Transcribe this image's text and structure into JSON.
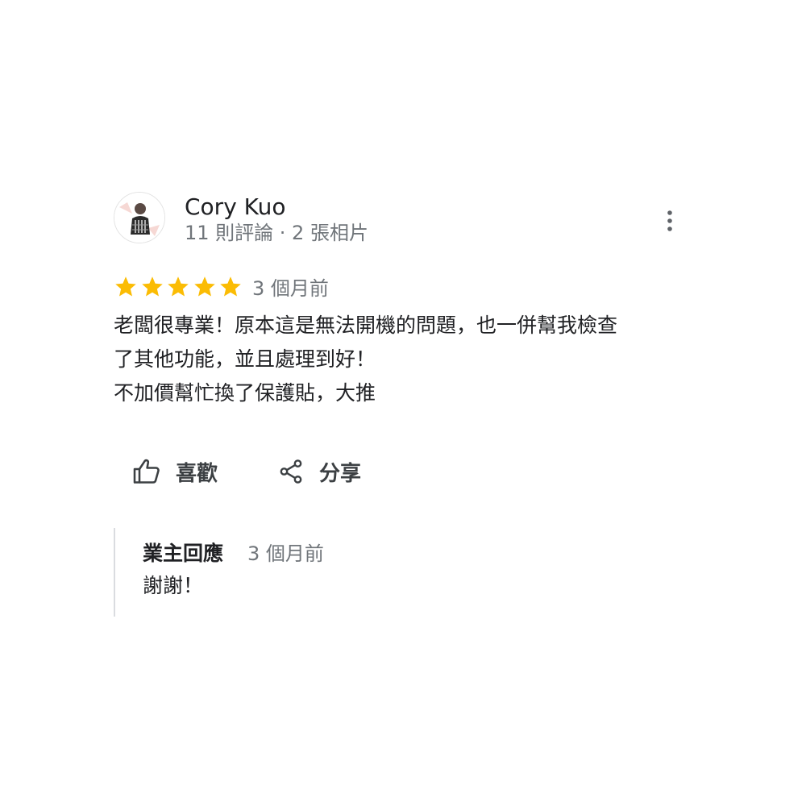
{
  "reviewer": {
    "name": "Cory Kuo",
    "meta": "11 則評論 · 2 張相片"
  },
  "review": {
    "rating": 5,
    "max_rating": 5,
    "star_color": "#fbbc04",
    "time": "3 個月前",
    "text_lines": [
      "老闆很專業！原本這是無法開機的問題，也一併幫我檢查",
      "了其他功能，並且處理到好！",
      "不加價幫忙換了保護貼，大推"
    ]
  },
  "actions": {
    "like_label": "喜歡",
    "like_icon": "thumbs-up-icon",
    "share_label": "分享",
    "share_icon": "share-icon",
    "more_icon": "more-vert-icon"
  },
  "owner_reply": {
    "title": "業主回應",
    "time": "3 個月前",
    "text": "謝謝！"
  }
}
